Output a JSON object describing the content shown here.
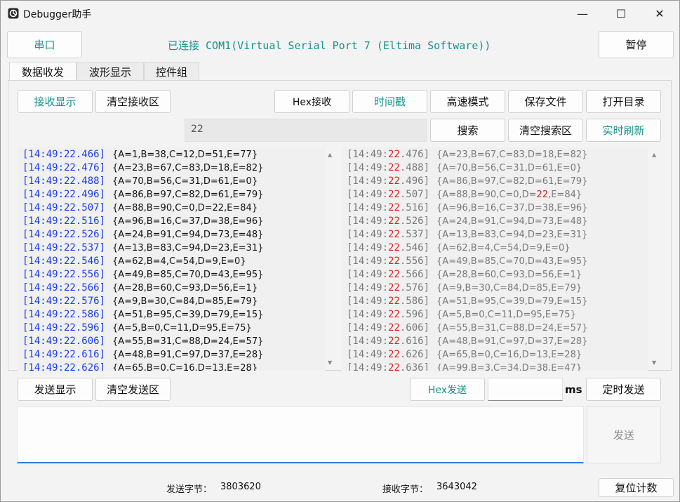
{
  "window": {
    "title": "Debugger助手",
    "minimize": "—",
    "maximize": "☐",
    "close": "✕"
  },
  "toolbar": {
    "port_label": "串口",
    "status_text": "已连接 COM1(Virtual Serial Port 7 (Eltima Software))",
    "pause_label": "暂停"
  },
  "tabs": [
    {
      "label": "数据收发",
      "active": true
    },
    {
      "label": "波形显示",
      "active": false
    },
    {
      "label": "控件组",
      "active": false
    }
  ],
  "receive_toolbar": {
    "show_receive": "接收显示",
    "clear_receive": "清空接收区",
    "hex_receive": "Hex接收",
    "timestamp": "时间戳",
    "high_speed": "高速模式",
    "save_file": "保存文件",
    "open_dir": "打开目录"
  },
  "search": {
    "value": "22",
    "search_label": "搜索",
    "clear_search": "清空搜索区",
    "live_refresh": "实时刷新"
  },
  "left_log": [
    {
      "ts": "[14:49:22.466]",
      "data": "{A=1,B=38,C=12,D=51,E=77}"
    },
    {
      "ts": "[14:49:22.476]",
      "data": "{A=23,B=67,C=83,D=18,E=82}"
    },
    {
      "ts": "[14:49:22.488]",
      "data": "{A=70,B=56,C=31,D=61,E=0}"
    },
    {
      "ts": "[14:49:22.496]",
      "data": "{A=86,B=97,C=82,D=61,E=79}"
    },
    {
      "ts": "[14:49:22.507]",
      "data": "{A=88,B=90,C=0,D=22,E=84}"
    },
    {
      "ts": "[14:49:22.516]",
      "data": "{A=96,B=16,C=37,D=38,E=96}"
    },
    {
      "ts": "[14:49:22.526]",
      "data": "{A=24,B=91,C=94,D=73,E=48}"
    },
    {
      "ts": "[14:49:22.537]",
      "data": "{A=13,B=83,C=94,D=23,E=31}"
    },
    {
      "ts": "[14:49:22.546]",
      "data": "{A=62,B=4,C=54,D=9,E=0}"
    },
    {
      "ts": "[14:49:22.556]",
      "data": "{A=49,B=85,C=70,D=43,E=95}"
    },
    {
      "ts": "[14:49:22.566]",
      "data": "{A=28,B=60,C=93,D=56,E=1}"
    },
    {
      "ts": "[14:49:22.576]",
      "data": "{A=9,B=30,C=84,D=85,E=79}"
    },
    {
      "ts": "[14:49:22.586]",
      "data": "{A=51,B=95,C=39,D=79,E=15}"
    },
    {
      "ts": "[14:49:22.596]",
      "data": "{A=5,B=0,C=11,D=95,E=75}"
    },
    {
      "ts": "[14:49:22.606]",
      "data": "{A=55,B=31,C=88,D=24,E=57}"
    },
    {
      "ts": "[14:49:22.616]",
      "data": "{A=48,B=91,C=97,D=37,E=28}"
    },
    {
      "ts": "[14:49:22.626]",
      "data": "{A=65,B=0,C=16,D=13,E=28}"
    }
  ],
  "right_log": [
    {
      "ts_a": "[14:49:",
      "ts_hl": "22",
      "ts_b": ".476]",
      "d_a": "{A=23,B=67,C=83,D=18,E=82}",
      "d_hl": "",
      "d_b": ""
    },
    {
      "ts_a": "[14:49:",
      "ts_hl": "22",
      "ts_b": ".488]",
      "d_a": "{A=70,B=56,C=31,D=61,E=0}",
      "d_hl": "",
      "d_b": ""
    },
    {
      "ts_a": "[14:49:",
      "ts_hl": "22",
      "ts_b": ".496]",
      "d_a": "{A=86,B=97,C=82,D=61,E=79}",
      "d_hl": "",
      "d_b": ""
    },
    {
      "ts_a": "[14:49:",
      "ts_hl": "22",
      "ts_b": ".507]",
      "d_a": "{A=88,B=90,C=0,D=",
      "d_hl": "22",
      "d_b": ",E=84}"
    },
    {
      "ts_a": "[14:49:",
      "ts_hl": "22",
      "ts_b": ".516]",
      "d_a": "{A=96,B=16,C=37,D=38,E=96}",
      "d_hl": "",
      "d_b": ""
    },
    {
      "ts_a": "[14:49:",
      "ts_hl": "22",
      "ts_b": ".526]",
      "d_a": "{A=24,B=91,C=94,D=73,E=48}",
      "d_hl": "",
      "d_b": ""
    },
    {
      "ts_a": "[14:49:",
      "ts_hl": "22",
      "ts_b": ".537]",
      "d_a": "{A=13,B=83,C=94,D=23,E=31}",
      "d_hl": "",
      "d_b": ""
    },
    {
      "ts_a": "[14:49:",
      "ts_hl": "22",
      "ts_b": ".546]",
      "d_a": "{A=62,B=4,C=54,D=9,E=0}",
      "d_hl": "",
      "d_b": ""
    },
    {
      "ts_a": "[14:49:",
      "ts_hl": "22",
      "ts_b": ".556]",
      "d_a": "{A=49,B=85,C=70,D=43,E=95}",
      "d_hl": "",
      "d_b": ""
    },
    {
      "ts_a": "[14:49:",
      "ts_hl": "22",
      "ts_b": ".566]",
      "d_a": "{A=28,B=60,C=93,D=56,E=1}",
      "d_hl": "",
      "d_b": ""
    },
    {
      "ts_a": "[14:49:",
      "ts_hl": "22",
      "ts_b": ".576]",
      "d_a": "{A=9,B=30,C=84,D=85,E=79}",
      "d_hl": "",
      "d_b": ""
    },
    {
      "ts_a": "[14:49:",
      "ts_hl": "22",
      "ts_b": ".586]",
      "d_a": "{A=51,B=95,C=39,D=79,E=15}",
      "d_hl": "",
      "d_b": ""
    },
    {
      "ts_a": "[14:49:",
      "ts_hl": "22",
      "ts_b": ".596]",
      "d_a": "{A=5,B=0,C=11,D=95,E=75}",
      "d_hl": "",
      "d_b": ""
    },
    {
      "ts_a": "[14:49:",
      "ts_hl": "22",
      "ts_b": ".606]",
      "d_a": "{A=55,B=31,C=88,D=24,E=57}",
      "d_hl": "",
      "d_b": ""
    },
    {
      "ts_a": "[14:49:",
      "ts_hl": "22",
      "ts_b": ".616]",
      "d_a": "{A=48,B=91,C=97,D=37,E=28}",
      "d_hl": "",
      "d_b": ""
    },
    {
      "ts_a": "[14:49:",
      "ts_hl": "22",
      "ts_b": ".626]",
      "d_a": "{A=65,B=0,C=16,D=13,E=28}",
      "d_hl": "",
      "d_b": ""
    },
    {
      "ts_a": "[14:49:",
      "ts_hl": "22",
      "ts_b": ".636]",
      "d_a": "{A=99,B=3,C=34,D=38,E=47}",
      "d_hl": "",
      "d_b": ""
    }
  ],
  "send_toolbar": {
    "show_send": "发送显示",
    "clear_send": "清空发送区",
    "hex_send": "Hex发送",
    "timer_value": "",
    "ms_label": "ms",
    "timed_send": "定时发送"
  },
  "send": {
    "input_value": "",
    "send_label": "发送"
  },
  "footer": {
    "sent_label": "发送字节：",
    "sent_value": "3803620",
    "recv_label": "接收字节：",
    "recv_value": "3643042",
    "reset_label": "复位计数"
  },
  "colors": {
    "accent": "#17938b",
    "timestamp_blue": "#1a3cf0",
    "highlight_red": "#e02020"
  }
}
